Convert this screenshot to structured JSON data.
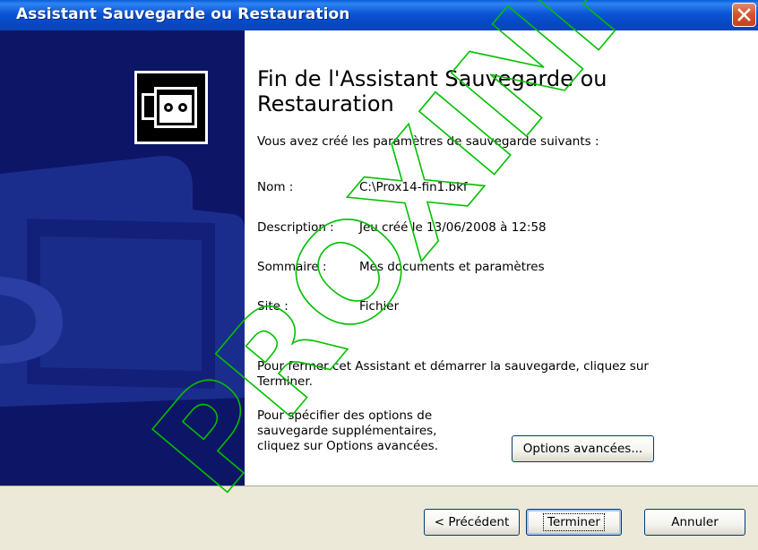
{
  "window": {
    "title": "Assistant Sauvegarde ou Restauration"
  },
  "content": {
    "heading": "Fin de l'Assistant Sauvegarde ou Restauration",
    "intro": "Vous avez créé les paramètres de sauvegarde suivants :",
    "fields": [
      {
        "label": "Nom :",
        "value": "C:\\Prox14-fin1.bkf"
      },
      {
        "label": "Description :",
        "value": "Jeu créé le 13/06/2008 à 12:58"
      },
      {
        "label": "Sommaire :",
        "value": "Mes documents et paramètres"
      },
      {
        "label": "Site :",
        "value": "Fichier"
      }
    ],
    "finish_instruction": "Pour fermer cet Assistant et démarrer la sauvegarde, cliquez sur Terminer.",
    "options_instruction": "Pour spécifier des options de sauvegarde supplémentaires, cliquez sur Options avancées."
  },
  "buttons": {
    "options": "Options avancées...",
    "back": "< Précédent",
    "finish": "Terminer",
    "cancel": "Annuler"
  },
  "watermark": {
    "text": "PROXINFO"
  }
}
